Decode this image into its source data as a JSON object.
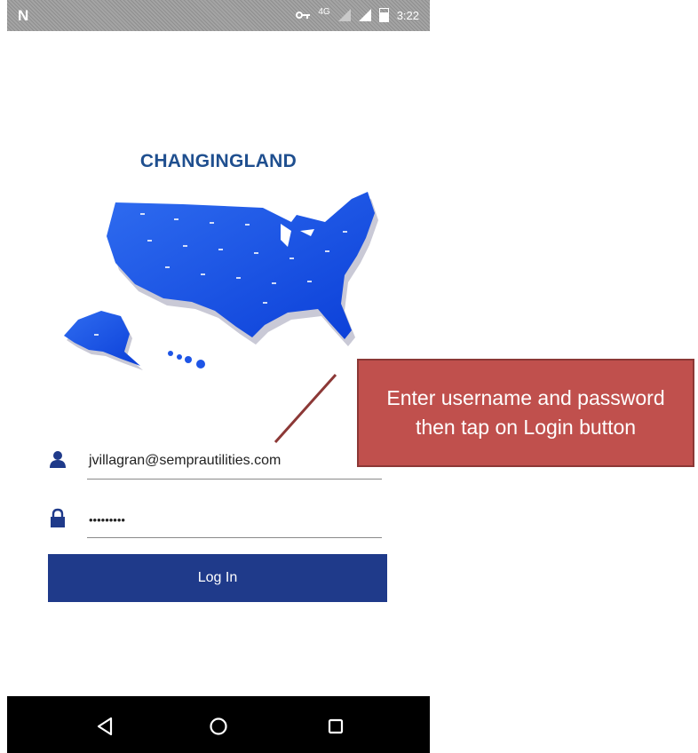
{
  "status_bar": {
    "left_icon": "N",
    "key_icon": "key-icon",
    "network": "4G",
    "time": "3:22"
  },
  "app": {
    "title": "CHANGINGLAND",
    "map_icon": "usa-map-icon"
  },
  "form": {
    "username": {
      "icon": "user-icon",
      "value": "jvillagran@semprautilities.com"
    },
    "password": {
      "icon": "lock-icon",
      "value": "•••••••••"
    },
    "login_label": "Log In",
    "accent_color": "#1f3a8a"
  },
  "nav_bar": {
    "back": "back-icon",
    "home": "home-icon",
    "recents": "recents-icon"
  },
  "annotation": {
    "text": "Enter username and password then tap on Login button",
    "color": "#c0504d"
  }
}
